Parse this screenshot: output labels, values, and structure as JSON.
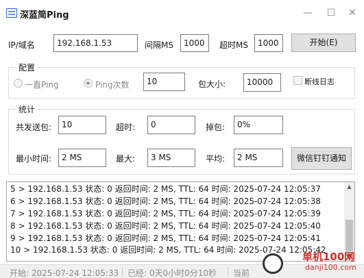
{
  "window": {
    "title": "深蓝简Ping",
    "minimize_glyph": "—",
    "maximize_glyph": "☐",
    "close_glyph": "✕"
  },
  "top_row": {
    "ip_label": "IP/域名",
    "ip_value": "192.168.1.53",
    "interval_label": "间隔MS",
    "interval_value": "1000",
    "timeout_label": "超时MS",
    "timeout_value": "1000",
    "start_button": "开始(E)"
  },
  "config": {
    "group_title": "配置",
    "radio_always": "一直Ping",
    "radio_count": "Ping次数",
    "count_value": "10",
    "packet_label": "包大小:",
    "packet_value": "10000",
    "disconnect_log": "断线日志"
  },
  "stats": {
    "group_title": "统计",
    "sent_label": "共发送包:",
    "sent_value": "10",
    "timeout_label": "超时:",
    "timeout_value": "0",
    "lost_label": "掉包:",
    "lost_value": "0%",
    "min_label": "最小时间:",
    "min_value": "2 MS",
    "max_label": "最大:",
    "max_value": "3 MS",
    "avg_label": "平均:",
    "avg_value": "2 MS",
    "notify_button": "微信钉钉通知"
  },
  "log": {
    "lines": [
      "5 > 192.168.1.53 状态: 0 返回时间: 2 MS, TTL: 64 时间: 2025-07-24 12:05:37",
      "6 > 192.168.1.53 状态: 0 返回时间: 2 MS, TTL: 64 时间: 2025-07-24 12:05:38",
      "7 > 192.168.1.53 状态: 0 返回时间: 2 MS, TTL: 64 时间: 2025-07-24 12:05:39",
      "8 > 192.168.1.53 状态: 0 返回时间: 2 MS, TTL: 64 时间: 2025-07-24 12:05:40",
      "9 > 192.168.1.53 状态: 0 返回时间: 2 MS, TTL: 64 时间: 2025-07-24 12:05:41",
      "10 > 192.168.1.53 状态: 0 返回时间: 2 MS, TTL: 64 时间: 2025-07-24 12:05:42"
    ]
  },
  "status": {
    "start_text": "开始:  2025-07-24 12:05:33",
    "elapsed_text": "已经: 0天0小时0分10秒",
    "current_text": "当前"
  },
  "watermark": {
    "line1": "单机100网",
    "line2": "danji100.com"
  }
}
